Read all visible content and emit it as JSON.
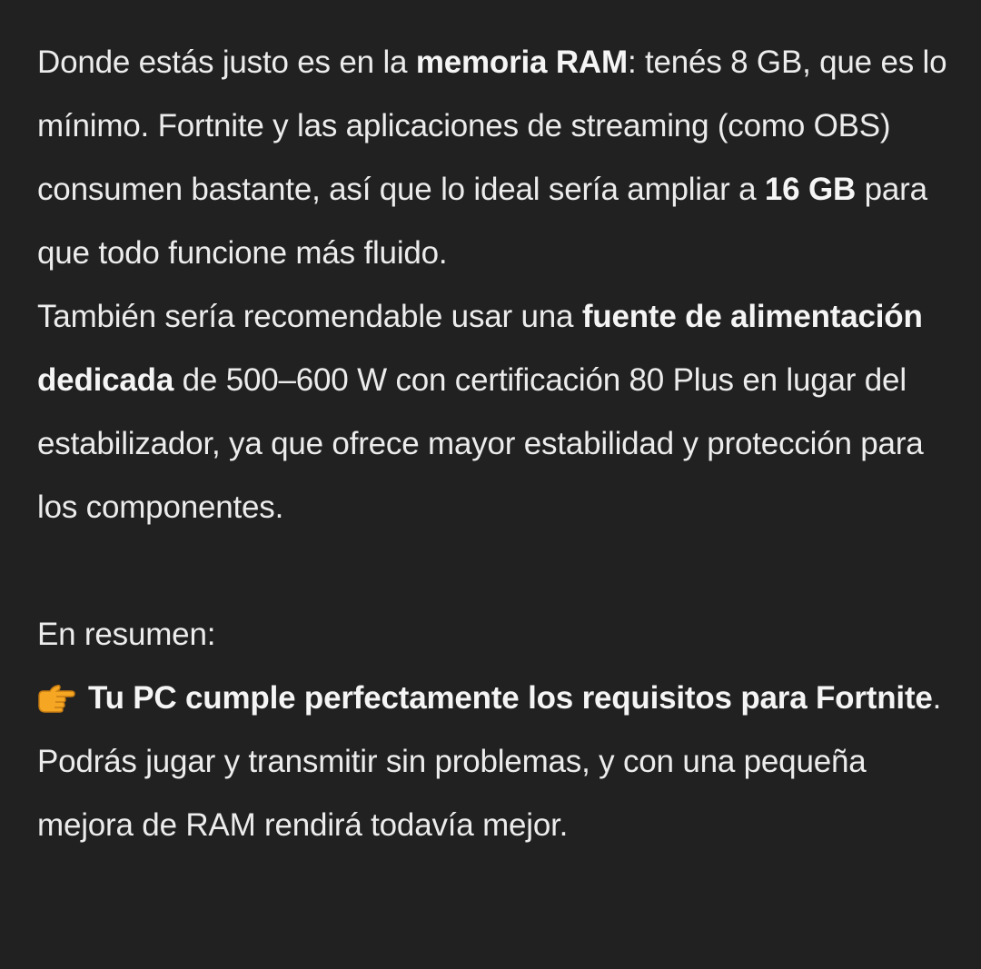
{
  "message": {
    "p1": {
      "t1": "Donde estás justo es en la ",
      "b1": "memoria RAM",
      "t2": ": tenés 8 GB, que es lo mínimo. Fortnite y las aplicaciones de streaming (como OBS) consumen bastante, así que lo ideal sería ampliar a ",
      "b2": "16 GB",
      "t3": " para que todo funcione más fluido."
    },
    "p2": {
      "t1": "También sería recomendable usar una ",
      "b1": "fuente de alimentación dedicada",
      "t2": " de 500–600 W con certificación 80 Plus en lugar del estabilizador, ya que ofrece mayor estabilidad y protección para los componentes."
    },
    "p3": {
      "t1": "En resumen:"
    },
    "p4": {
      "icon": "pointing-right-hand-emoji",
      "b1": "Tu PC cumple perfectamente los requisitos para Fortnite",
      "t1": "."
    },
    "p5": {
      "t1": "Podrás jugar y transmitir sin problemas, y con una pequeña mejora de RAM rendirá todavía mejor."
    }
  },
  "colors": {
    "background": "#212121",
    "text": "#ececec",
    "emoji": "#f5a623"
  }
}
